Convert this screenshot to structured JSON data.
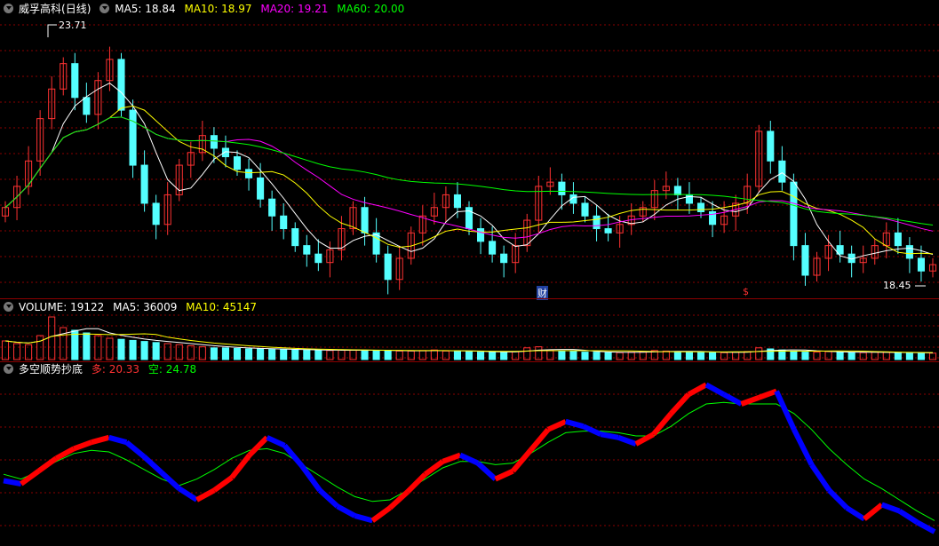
{
  "main": {
    "title": "威孚高科",
    "period": "(日线)",
    "ma5": "MA5: 18.84",
    "ma10": "MA10: 18.97",
    "ma20": "MA20: 19.21",
    "ma60": "MA60: 20.00",
    "high_label": "23.71",
    "low_label": "18.45",
    "marker_cai": "财",
    "marker_s": "$"
  },
  "volume": {
    "label": "VOLUME: 19122",
    "ma5": "MA5: 36009",
    "ma10": "MA10: 45147"
  },
  "indicator": {
    "title": "多空顺势抄底",
    "duo": "多: 20.33",
    "kong": "空: 24.78"
  },
  "colors": {
    "up": "#ff3232",
    "down": "#54ffff",
    "ma5": "#ffffff",
    "ma10": "#ffff00",
    "ma20": "#ff00ff",
    "ma60": "#00ff00",
    "ind_up": "#ff0000",
    "ind_down": "#0000ff",
    "grid": "#8b0000"
  },
  "chart_data": [
    {
      "type": "candlestick",
      "panel": "price",
      "y_range": [
        18.2,
        24.2
      ],
      "close_path": [
        19.8,
        20.3,
        20.9,
        21.9,
        22.6,
        23.2,
        22.4,
        22.0,
        22.8,
        23.3,
        22.1,
        20.8,
        19.9,
        19.4,
        20.1,
        20.8,
        21.1,
        21.5,
        21.2,
        21.0,
        20.7,
        20.5,
        20.0,
        19.6,
        19.3,
        18.9,
        18.7,
        18.5,
        18.8,
        19.3,
        19.8,
        19.2,
        18.7,
        18.1,
        18.6,
        19.2,
        19.6,
        19.8,
        20.1,
        19.8,
        19.3,
        19.0,
        18.7,
        18.5,
        18.9,
        19.5,
        20.3,
        20.4,
        20.1,
        19.9,
        19.6,
        19.3,
        19.2,
        19.4,
        19.6,
        19.8,
        20.2,
        20.3,
        20.1,
        19.9,
        19.7,
        19.4,
        19.6,
        19.9,
        20.3,
        21.6,
        20.9,
        20.4,
        18.9,
        18.2,
        18.6,
        18.9,
        18.7,
        18.5,
        18.6,
        18.9,
        19.2,
        18.9,
        18.6,
        18.3,
        18.45
      ],
      "high": 23.71,
      "low": 18.45
    },
    {
      "type": "bar",
      "panel": "volume",
      "values": [
        35,
        30,
        28,
        45,
        80,
        60,
        55,
        50,
        45,
        40,
        38,
        36,
        34,
        32,
        30,
        28,
        26,
        24,
        22,
        22,
        21,
        20,
        20,
        19,
        19,
        18,
        18,
        17,
        17,
        18,
        18,
        17,
        17,
        16,
        16,
        16,
        17,
        18,
        16,
        15,
        15,
        14,
        14,
        14,
        15,
        22,
        24,
        18,
        16,
        15,
        14,
        14,
        13,
        13,
        14,
        15,
        17,
        16,
        15,
        14,
        14,
        13,
        13,
        14,
        15,
        22,
        20,
        18,
        16,
        14,
        14,
        15,
        14,
        13,
        13,
        14,
        14,
        13,
        12,
        12,
        12
      ]
    },
    {
      "type": "line",
      "panel": "indicator",
      "series": [
        {
          "name": "多",
          "values": [
            22.2,
            22.0,
            22.8,
            23.6,
            24.2,
            24.6,
            24.9,
            24.6,
            23.7,
            22.7,
            21.7,
            21.0,
            21.6,
            22.4,
            23.8,
            24.9,
            24.4,
            23.1,
            21.6,
            20.6,
            20.0,
            19.7,
            20.5,
            21.5,
            22.6,
            23.4,
            23.8,
            23.3,
            22.3,
            22.8,
            24.1,
            25.4,
            25.9,
            25.6,
            25.1,
            24.9,
            24.5,
            25.1,
            26.4,
            27.6,
            28.2,
            27.6,
            27.0,
            27.4,
            27.8,
            25.4,
            23.2,
            21.6,
            20.5,
            19.8,
            20.7,
            20.3,
            19.6,
            19.0
          ]
        },
        {
          "name": "空",
          "values": [
            22.6,
            22.3,
            22.8,
            23.4,
            23.9,
            24.1,
            24.0,
            23.5,
            22.9,
            22.3,
            21.9,
            22.3,
            22.9,
            23.6,
            24.1,
            24.2,
            23.9,
            23.2,
            22.5,
            21.8,
            21.2,
            20.9,
            21.0,
            21.6,
            22.3,
            23.0,
            23.4,
            23.4,
            23.2,
            23.3,
            23.9,
            24.6,
            25.2,
            25.3,
            25.3,
            25.2,
            25.0,
            25.0,
            25.6,
            26.4,
            27.0,
            27.1,
            27.0,
            27.0,
            27.0,
            26.4,
            25.4,
            24.2,
            23.2,
            22.3,
            21.7,
            21.0,
            20.3,
            19.7
          ]
        }
      ]
    }
  ]
}
